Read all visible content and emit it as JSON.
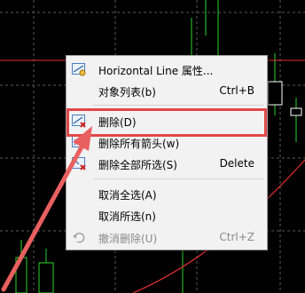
{
  "menu": {
    "items": [
      {
        "label": "Horizontal Line 属性...",
        "shortcut": "",
        "icon": "line-properties-icon",
        "disabled": false
      },
      {
        "label": "对象列表(b)",
        "shortcut": "Ctrl+B",
        "icon": "",
        "disabled": false
      },
      {
        "label": "删除(D)",
        "shortcut": "",
        "icon": "delete-object-icon",
        "disabled": false
      },
      {
        "label": "删除所有箭头(w)",
        "shortcut": "",
        "icon": "delete-arrows-icon",
        "disabled": false
      },
      {
        "label": "删除全部所选(S)",
        "shortcut": "Delete",
        "icon": "delete-selected-icon",
        "disabled": false
      },
      {
        "label": "取消全选(A)",
        "shortcut": "",
        "icon": "",
        "disabled": false
      },
      {
        "label": "取消所选(n)",
        "shortcut": "",
        "icon": "",
        "disabled": false
      },
      {
        "label": "撤消删除(U)",
        "shortcut": "Ctrl+Z",
        "icon": "undo-icon",
        "disabled": true
      }
    ]
  },
  "colors": {
    "background": "#000000",
    "grid": "#5a5a5a",
    "candle_bull": "#2bd42b",
    "horizontal_line": "#e63030",
    "curve": "#e63030",
    "highlight": "#e04848"
  }
}
